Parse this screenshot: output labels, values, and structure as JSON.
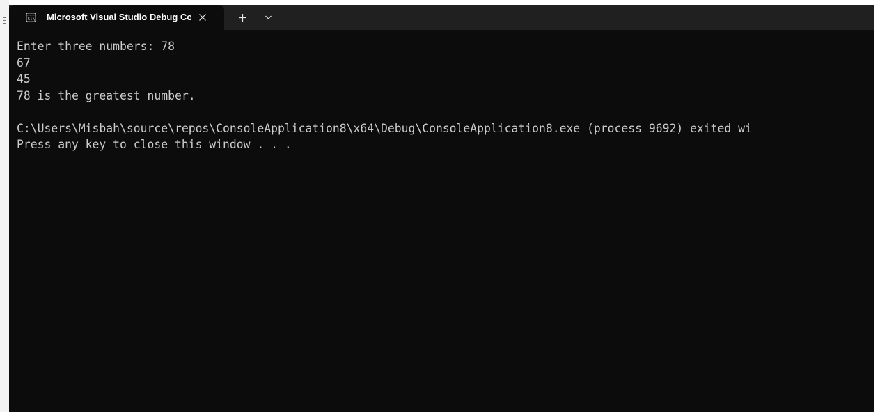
{
  "tab": {
    "title": "Microsoft Visual Studio Debug Console",
    "icon": "console-icon",
    "close_icon": "close-icon",
    "new_tab_icon": "plus-icon",
    "dropdown_icon": "chevron-down-icon"
  },
  "console": {
    "lines": [
      "Enter three numbers: 78",
      "67",
      "45",
      "78 is the greatest number.",
      "",
      "C:\\Users\\Misbah\\source\\repos\\ConsoleApplication8\\x64\\Debug\\ConsoleApplication8.exe (process 9692) exited wi",
      "Press any key to close this window . . ."
    ]
  },
  "colors": {
    "console_bg": "#0c0c0c",
    "tabbar_bg": "#202020",
    "console_text": "#cccccc",
    "tab_text": "#ffffff"
  }
}
